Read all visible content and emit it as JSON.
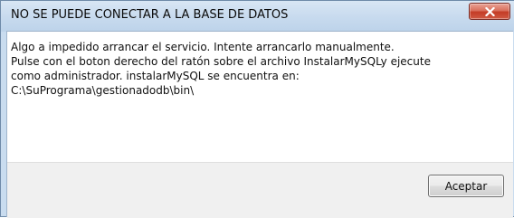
{
  "dialog": {
    "title": "NO SE PUEDE CONECTAR A LA BASE DE DATOS",
    "close_icon": "close-x-icon",
    "message_lines": [
      "Algo a impedido arrancar el servicio. Intente arrancarlo manualmente.",
      "Pulse con el boton derecho del ratón sobre el archivo InstalarMySQLy ejecute",
      "como administrador. instalarMySQL se encuentra en:",
      "C:\\SuPrograma\\gestionadodb\\bin\\"
    ],
    "ok_label": "Aceptar"
  },
  "colors": {
    "title_bar": "#c7daee",
    "close_button": "#c43c26",
    "body_background": "#ffffff",
    "button_area": "#f0f0f0"
  }
}
